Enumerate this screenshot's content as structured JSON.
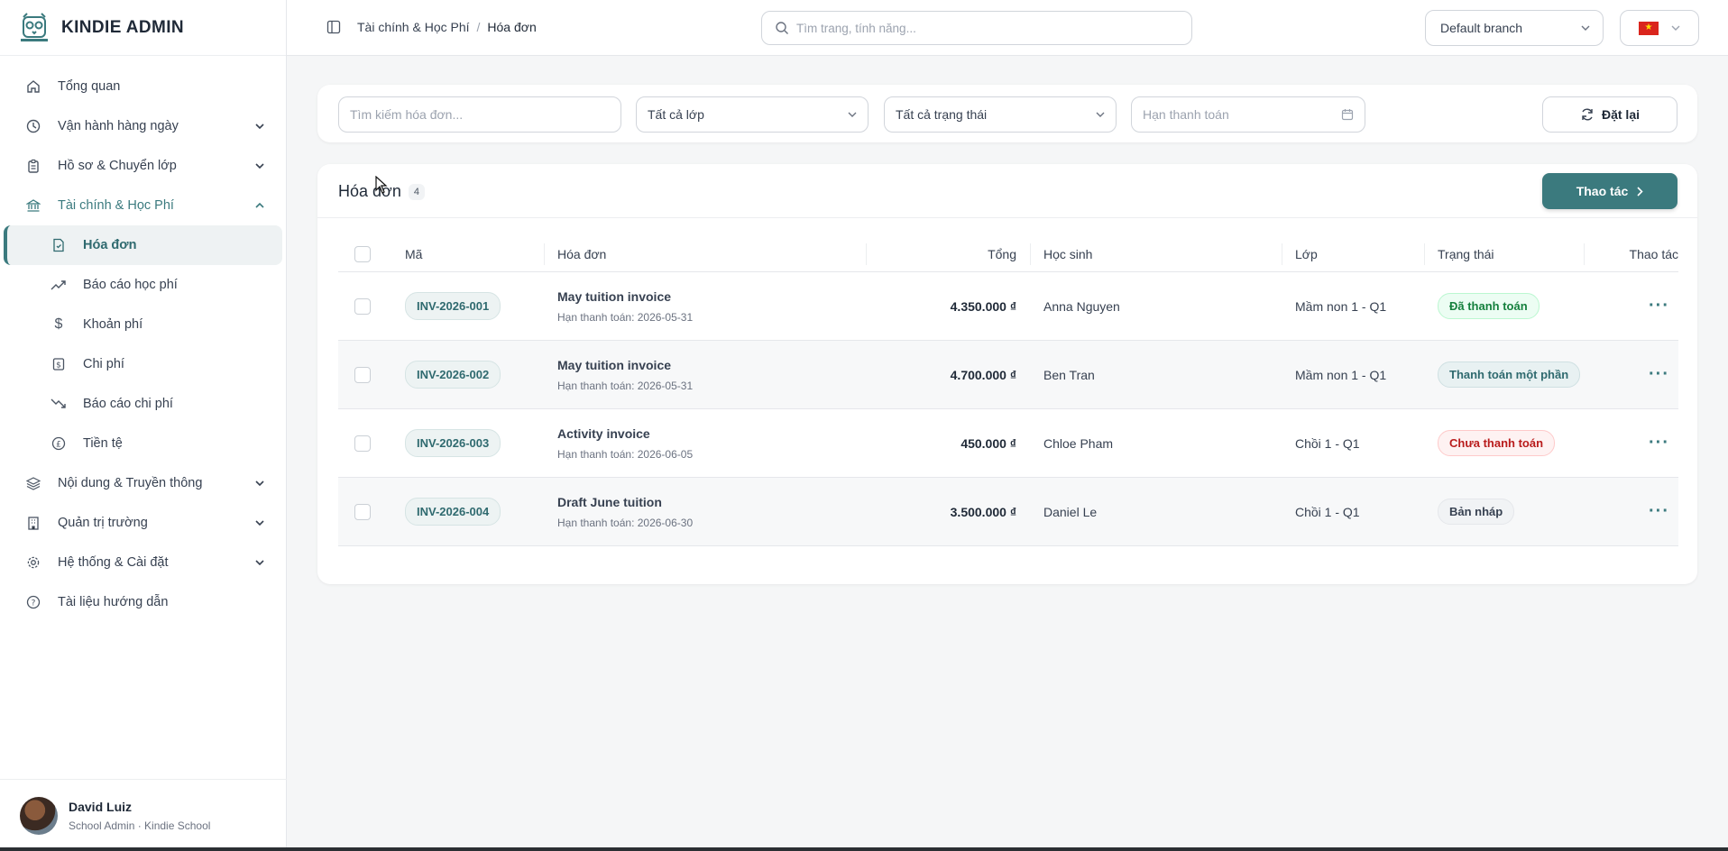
{
  "brand": {
    "name": "KINDIE ADMIN"
  },
  "sidebar": {
    "items": [
      {
        "label": "Tổng quan",
        "icon": "home-icon",
        "chevron": false
      },
      {
        "label": "Vận hành hàng ngày",
        "icon": "clock-icon",
        "chevron": true
      },
      {
        "label": "Hồ sơ & Chuyển lớp",
        "icon": "clipboard-icon",
        "chevron": true
      },
      {
        "label": "Tài chính & Học Phí",
        "icon": "bank-icon",
        "chevron": true,
        "expanded": true
      }
    ],
    "sub_items": [
      {
        "label": "Hóa đơn",
        "icon": "invoice-icon",
        "active": true
      },
      {
        "label": "Báo cáo học phí",
        "icon": "trending-up-icon"
      },
      {
        "label": "Khoản phí",
        "icon": "dollar-icon"
      },
      {
        "label": "Chi phí",
        "icon": "receipt-icon"
      },
      {
        "label": "Báo cáo chi phí",
        "icon": "trending-down-icon"
      },
      {
        "label": "Tiền tệ",
        "icon": "currency-icon"
      }
    ],
    "items_after": [
      {
        "label": "Nội dung & Truyền thông",
        "icon": "layers-icon",
        "chevron": true
      },
      {
        "label": "Quản trị trường",
        "icon": "building-icon",
        "chevron": true
      },
      {
        "label": "Hệ thống & Cài đặt",
        "icon": "gear-icon",
        "chevron": true
      },
      {
        "label": "Tài liệu hướng dẫn",
        "icon": "help-icon",
        "chevron": false
      }
    ]
  },
  "user": {
    "name": "David Luiz",
    "role": "School Admin · Kindie School"
  },
  "header": {
    "breadcrumb_parent": "Tài chính & Học Phí",
    "breadcrumb_sep": "/",
    "breadcrumb_current": "Hóa đơn",
    "search_placeholder": "Tìm trang, tính năng...",
    "branch": "Default branch"
  },
  "filters": {
    "search_placeholder": "Tìm kiếm hóa đơn...",
    "class_select": "Tất cả lớp",
    "status_select": "Tất cả trạng thái",
    "due_placeholder": "Hạn thanh toán",
    "reset_label": "Đặt lại"
  },
  "card": {
    "title": "Hóa đơn",
    "count": "4",
    "action_label": "Thao tác"
  },
  "table": {
    "columns": {
      "code": "Mã",
      "invoice": "Hóa đơn",
      "total": "Tổng",
      "student": "Học sinh",
      "class": "Lớp",
      "status": "Trạng thái",
      "actions": "Thao tác"
    },
    "rows": [
      {
        "code": "INV-2026-001",
        "title": "May tuition invoice",
        "due": "Hạn thanh toán: 2026-05-31",
        "total": "4.350.000 ₫",
        "student": "Anna Nguyen",
        "class": "Mầm non 1 - Q1",
        "status": "Đã thanh toán",
        "status_kind": "paid"
      },
      {
        "code": "INV-2026-002",
        "title": "May tuition invoice",
        "due": "Hạn thanh toán: 2026-05-31",
        "total": "4.700.000 ₫",
        "student": "Ben Tran",
        "class": "Mầm non 1 - Q1",
        "status": "Thanh toán một phần",
        "status_kind": "partial"
      },
      {
        "code": "INV-2026-003",
        "title": "Activity invoice",
        "due": "Hạn thanh toán: 2026-06-05",
        "total": "450.000 ₫",
        "student": "Chloe Pham",
        "class": "Chồi 1 - Q1",
        "status": "Chưa thanh toán",
        "status_kind": "unpaid"
      },
      {
        "code": "INV-2026-004",
        "title": "Draft June tuition",
        "due": "Hạn thanh toán: 2026-06-30",
        "total": "3.500.000 ₫",
        "student": "Daniel Le",
        "class": "Chồi 1 - Q1",
        "status": "Bản nháp",
        "status_kind": "draft"
      }
    ]
  },
  "colors": {
    "accent": "#3b7a7e",
    "paid": "#15803d",
    "unpaid": "#b91c1c"
  }
}
